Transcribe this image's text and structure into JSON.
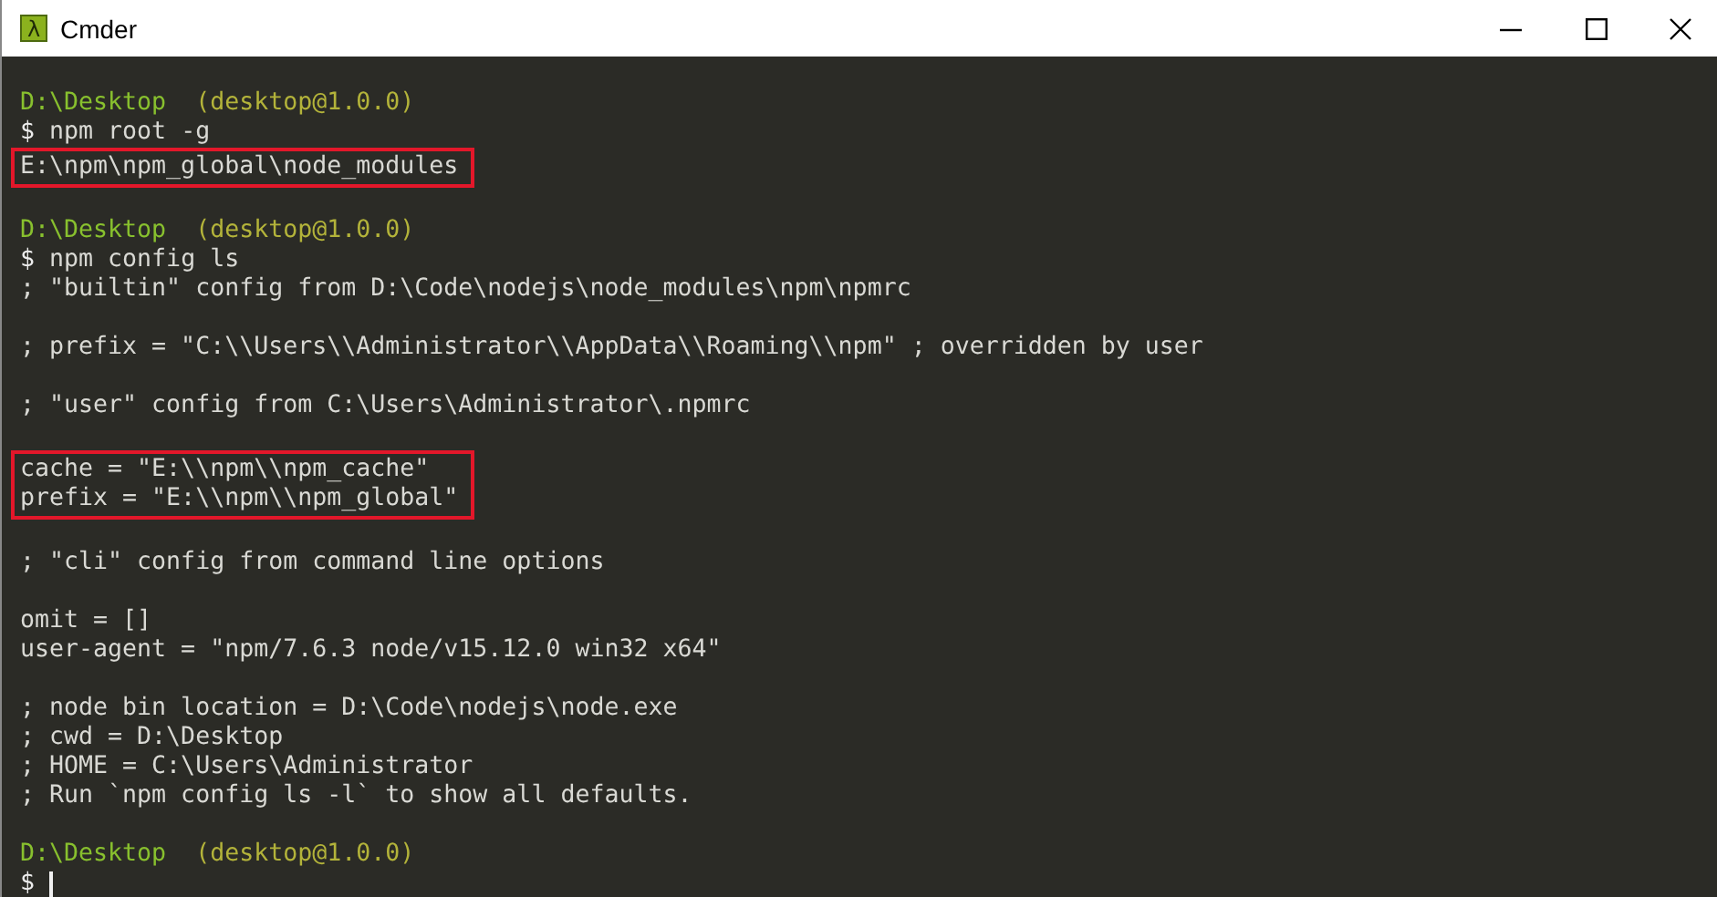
{
  "window": {
    "title": "Cmder",
    "app_icon_glyph": "λ"
  },
  "terminal": {
    "blocks": [
      {
        "highlighted": false,
        "lines": [
          {
            "kind": "blank"
          },
          {
            "kind": "prompt",
            "path": "D:\\Desktop",
            "package": "(desktop@1.0.0)"
          },
          {
            "kind": "command",
            "symbol": "$",
            "text": "npm root -g"
          }
        ]
      },
      {
        "highlighted": true,
        "lines": [
          {
            "kind": "output",
            "text": "E:\\npm\\npm_global\\node_modules"
          }
        ]
      },
      {
        "highlighted": false,
        "lines": [
          {
            "kind": "blank"
          },
          {
            "kind": "prompt",
            "path": "D:\\Desktop",
            "package": "(desktop@1.0.0)"
          },
          {
            "kind": "command",
            "symbol": "$",
            "text": "npm config ls"
          },
          {
            "kind": "output",
            "text": "; \"builtin\" config from D:\\Code\\nodejs\\node_modules\\npm\\npmrc"
          },
          {
            "kind": "blank"
          },
          {
            "kind": "output",
            "text": "; prefix = \"C:\\\\Users\\\\Administrator\\\\AppData\\\\Roaming\\\\npm\" ; overridden by user"
          },
          {
            "kind": "blank"
          },
          {
            "kind": "output",
            "text": "; \"user\" config from C:\\Users\\Administrator\\.npmrc"
          },
          {
            "kind": "blank"
          }
        ]
      },
      {
        "highlighted": true,
        "lines": [
          {
            "kind": "output",
            "text": "cache = \"E:\\\\npm\\\\npm_cache\""
          },
          {
            "kind": "output",
            "text": "prefix = \"E:\\\\npm\\\\npm_global\""
          }
        ]
      },
      {
        "highlighted": false,
        "lines": [
          {
            "kind": "blank"
          },
          {
            "kind": "output",
            "text": "; \"cli\" config from command line options"
          },
          {
            "kind": "blank"
          },
          {
            "kind": "output",
            "text": "omit = []"
          },
          {
            "kind": "output",
            "text": "user-agent = \"npm/7.6.3 node/v15.12.0 win32 x64\""
          },
          {
            "kind": "blank"
          },
          {
            "kind": "output",
            "text": "; node bin location = D:\\Code\\nodejs\\node.exe"
          },
          {
            "kind": "output",
            "text": "; cwd = D:\\Desktop"
          },
          {
            "kind": "output",
            "text": "; HOME = C:\\Users\\Administrator"
          },
          {
            "kind": "output",
            "text": "; Run `npm config ls -l` to show all defaults."
          },
          {
            "kind": "blank"
          },
          {
            "kind": "prompt",
            "path": "D:\\Desktop",
            "package": "(desktop@1.0.0)"
          },
          {
            "kind": "input",
            "symbol": "$"
          }
        ]
      }
    ]
  }
}
